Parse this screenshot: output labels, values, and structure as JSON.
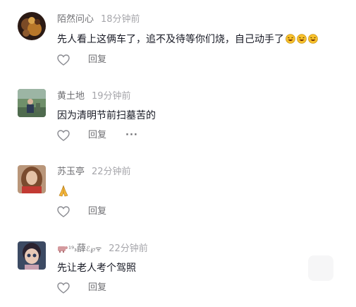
{
  "comments": [
    {
      "username": "陌然问心",
      "time": "18分钟前",
      "text": "先人看上这俩车了，追不及待等你们烧，自己动手了",
      "emoji": [
        "rofl-emoji",
        "rofl-emoji",
        "rofl-emoji"
      ],
      "reply_label": "回复"
    },
    {
      "username": "黄土地",
      "time": "19分钟前",
      "text": "因为清明节前扫墓苦的",
      "reply_label": "回复",
      "more_label": "···"
    },
    {
      "username": "苏玉亭",
      "time": "22分钟前",
      "text": "",
      "emoji": [
        "pray-emoji"
      ],
      "reply_label": "回复"
    },
    {
      "username_main": "薛",
      "username_prefix": "¹⁹₃",
      "username_suffix": "ℰ℘ᯤ",
      "time": "22分钟前",
      "text": "先让老人考个驾照",
      "reply_label": "回复"
    }
  ],
  "colors": {
    "text_primary": "#161823",
    "text_secondary": "#6f6f73",
    "text_muted": "#a6a6ab",
    "background": "#ffffff"
  }
}
